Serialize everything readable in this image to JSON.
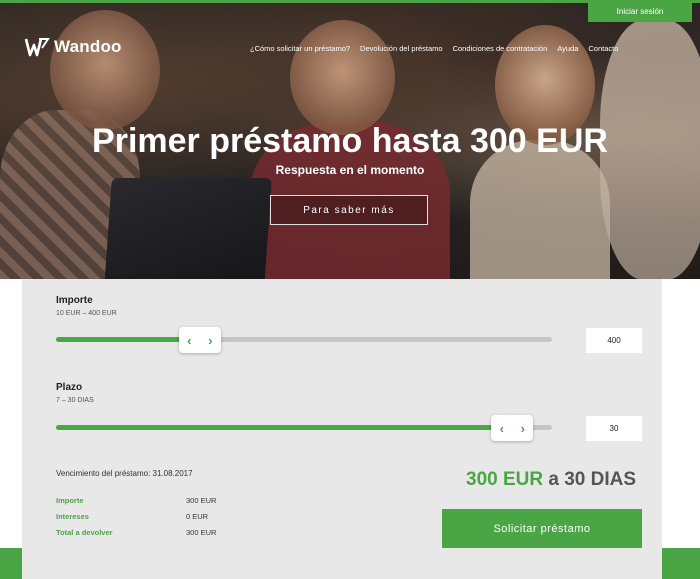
{
  "header": {
    "login_label": "Iniciar sesión",
    "logo_text": "Wandoo",
    "nav": [
      "¿Cómo solicitar un préstamo?",
      "Devolución del préstamo",
      "Condiciones de contratación",
      "Ayuda",
      "Contacto"
    ]
  },
  "hero": {
    "title": "Primer préstamo hasta 300 EUR",
    "subtitle": "Respuesta en el momento",
    "more_label": "Para saber más"
  },
  "calculator": {
    "amount": {
      "label": "Importe",
      "range": "10 EUR – 400 EUR",
      "value": "400",
      "fill_fraction": 0.29
    },
    "term": {
      "label": "Plazo",
      "range": "7 – 30 DIAS",
      "value": "30",
      "fill_fraction": 0.92
    },
    "due_date": "Vencimiento del préstamo: 31.08.2017",
    "summary": [
      {
        "key": "Importe",
        "value": "300 EUR"
      },
      {
        "key": "Intereses",
        "value": "0 EUR"
      },
      {
        "key": "Total a devolver",
        "value": "300 EUR"
      }
    ],
    "total_amount": "300 EUR",
    "total_term": "a 30 DIAS",
    "request_label": "Solicitar préstamo"
  },
  "colors": {
    "accent": "#4aa644",
    "panel_bg": "#e8e8e8"
  },
  "icons": {
    "handle_left": "‹",
    "handle_right": "›"
  }
}
